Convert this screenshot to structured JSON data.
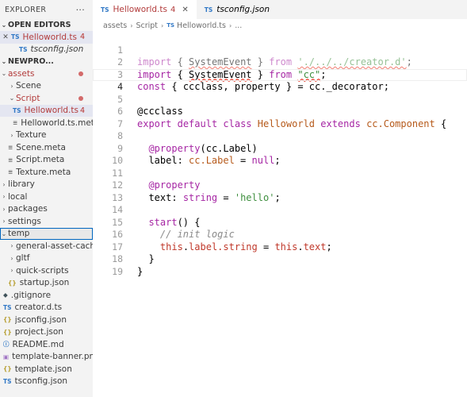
{
  "sidebar": {
    "title": "EXPLORER",
    "more": "···",
    "open_editors_title": "OPEN EDITORS",
    "open_editors": [
      {
        "close": "✕",
        "icon": "TS",
        "name": "Helloworld.ts",
        "badge": "4"
      },
      {
        "icon": "TS",
        "name": "tsconfig.json"
      }
    ],
    "project_title": "NEWPRO...",
    "tree": {
      "assets": "assets",
      "scene": "Scene",
      "script": "Script",
      "helloworld_ts": "Helloworld.ts",
      "helloworld_badge": "4",
      "helloworld_meta": "Helloworld.ts.meta",
      "texture": "Texture",
      "scene_meta": "Scene.meta",
      "script_meta": "Script.meta",
      "texture_meta": "Texture.meta",
      "library": "library",
      "local": "local",
      "packages": "packages",
      "settings": "settings",
      "temp": "temp",
      "general_asset_caches": "general-asset-caches",
      "gltf": "gltf",
      "quick_scripts": "quick-scripts",
      "startup_json": "startup.json",
      "gitignore": ".gitignore",
      "creator_d_ts": "creator.d.ts",
      "jsconfig_json": "jsconfig.json",
      "project_json": "project.json",
      "readme_md": "README.md",
      "template_banner_png": "template-banner.png",
      "template_json": "template.json",
      "tsconfig_json": "tsconfig.json"
    }
  },
  "tabs": [
    {
      "icon": "TS",
      "label": "Helloworld.ts",
      "count": "4",
      "close": "✕"
    },
    {
      "icon": "TS",
      "label": "tsconfig.json"
    }
  ],
  "breadcrumb": {
    "parts": [
      "assets",
      "Script",
      "Helloworld.ts",
      "..."
    ],
    "file_icon": "TS"
  },
  "editor": {
    "current_line": 4,
    "line_numbers": [
      "1",
      "2",
      "3",
      "4",
      "5",
      "6",
      "7",
      "8",
      "9",
      "10",
      "11",
      "12",
      "13",
      "14",
      "15",
      "16",
      "17",
      "18",
      "19"
    ],
    "code": {
      "l1_import": "import",
      "l1_ident": "SystemEvent",
      "l1_from": "from",
      "l1_path": "'./../../creator.d'",
      "l2_import": "import",
      "l2_ident": "SystemEvent",
      "l2_from": "from",
      "l2_path": "\"cc\"",
      "l3_const": "const",
      "l3_vars": "ccclass, property",
      "l3_rhs": "cc._decorator",
      "l5_decorator": "@ccclass",
      "l6_export": "export",
      "l6_default": "default",
      "l6_class": "class",
      "l6_name": "Helloworld",
      "l6_extends": "extends",
      "l6_base": "cc.Component",
      "l8_decorator": "@property",
      "l8_arg": "cc.Label",
      "l9_name": "label",
      "l9_type": "cc.Label",
      "l9_value": "null",
      "l11_decorator": "@property",
      "l12_name": "text",
      "l12_type": "string",
      "l12_value": "'hello'",
      "l14_method": "start",
      "l15_comment": "// init logic",
      "l16_this1": "this",
      "l16_member": "label.string",
      "l16_this2": "this",
      "l16_prop": "text"
    }
  },
  "colors": {
    "keyword": "#a626a4",
    "string": "#3f8f3f",
    "error": "#b23b3b",
    "ts_icon": "#3178c6",
    "json_icon": "#b8a034"
  }
}
